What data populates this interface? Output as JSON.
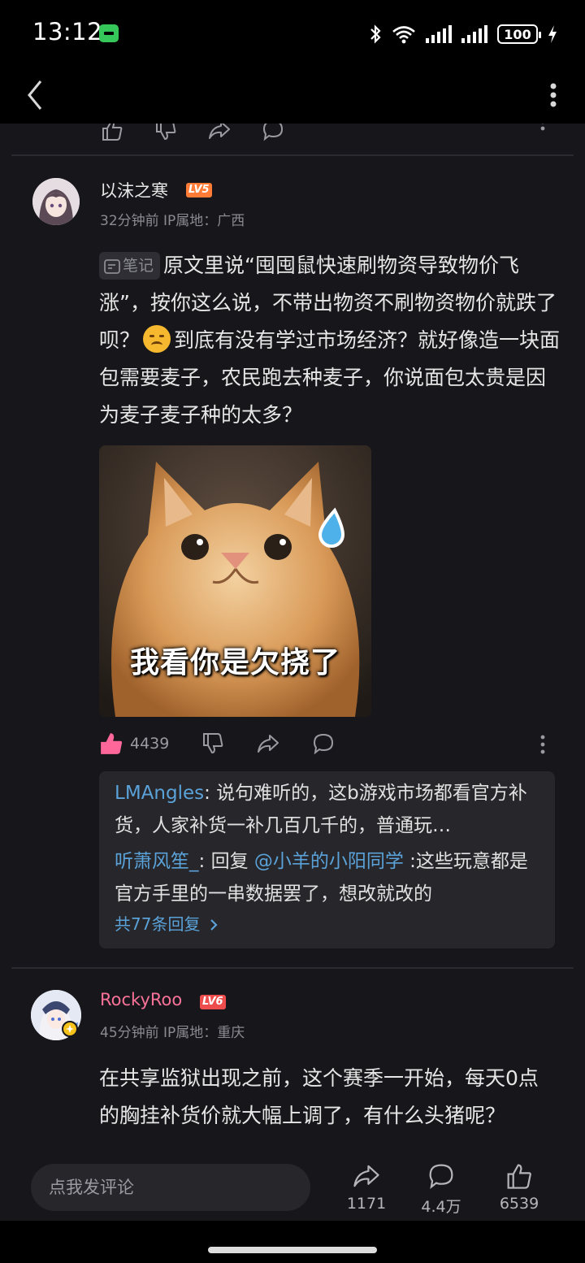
{
  "status": {
    "time": "13:12",
    "battery": "100"
  },
  "comments": [
    {
      "username": "以沫之寒",
      "level": "LV5",
      "time_ip": "32分钟前 IP属地：广西",
      "note_tag": "笔记",
      "text_part1": "原文里说“囤囤鼠快速刷物资导致物价飞涨”，按你这么说，不带出物资不刷物资物价就跌了呗？",
      "text_part2": "到底有没有学过市场经济？就好像造一块面包需要麦子，农民跑去种麦子，你说面包太贵是因为麦子麦子种的太多？",
      "meme_caption": "我看你是欠挠了",
      "like_count": "4439",
      "replies": [
        {
          "user": "LMAngles",
          "sep": ": ",
          "text": "说句难听的，这b游戏市场都看官方补货，人家补货一补几百几千的，普通玩…"
        },
        {
          "user": "听萧风笙_",
          "sep": ": ",
          "reply_word": "回复 ",
          "mention": "@小羊的小阳同学",
          "text": " :这些玩意都是官方手里的一串数据罢了，想改就改的"
        }
      ],
      "replies_more": "共77条回复"
    },
    {
      "username": "RockyRoo",
      "level": "LV6",
      "time_ip": "45分钟前 IP属地：重庆",
      "text": "在共享监狱出现之前，这个赛季一开始，每天0点的胸挂补货价就大幅上调了，有什么头猪呢？"
    }
  ],
  "bottom_bar": {
    "input_placeholder": "点我发评论",
    "share_count": "1171",
    "comment_count": "4.4万",
    "like_count": "6539"
  },
  "colors": {
    "background": "#17171b",
    "link_blue": "#5aa2d8",
    "like_pink": "#ff6699",
    "lv5_orange": "#ff7b36",
    "lv6_red": "#ee4d4d",
    "username_pink": "#fb7299"
  },
  "icons": [
    "back-arrow-icon",
    "more-vertical-icon",
    "thumb-up-icon",
    "thumb-down-icon",
    "share-icon",
    "comment-icon",
    "note-icon",
    "chevron-right-icon",
    "bluetooth-icon",
    "wifi-icon",
    "signal-icon",
    "charging-icon"
  ]
}
